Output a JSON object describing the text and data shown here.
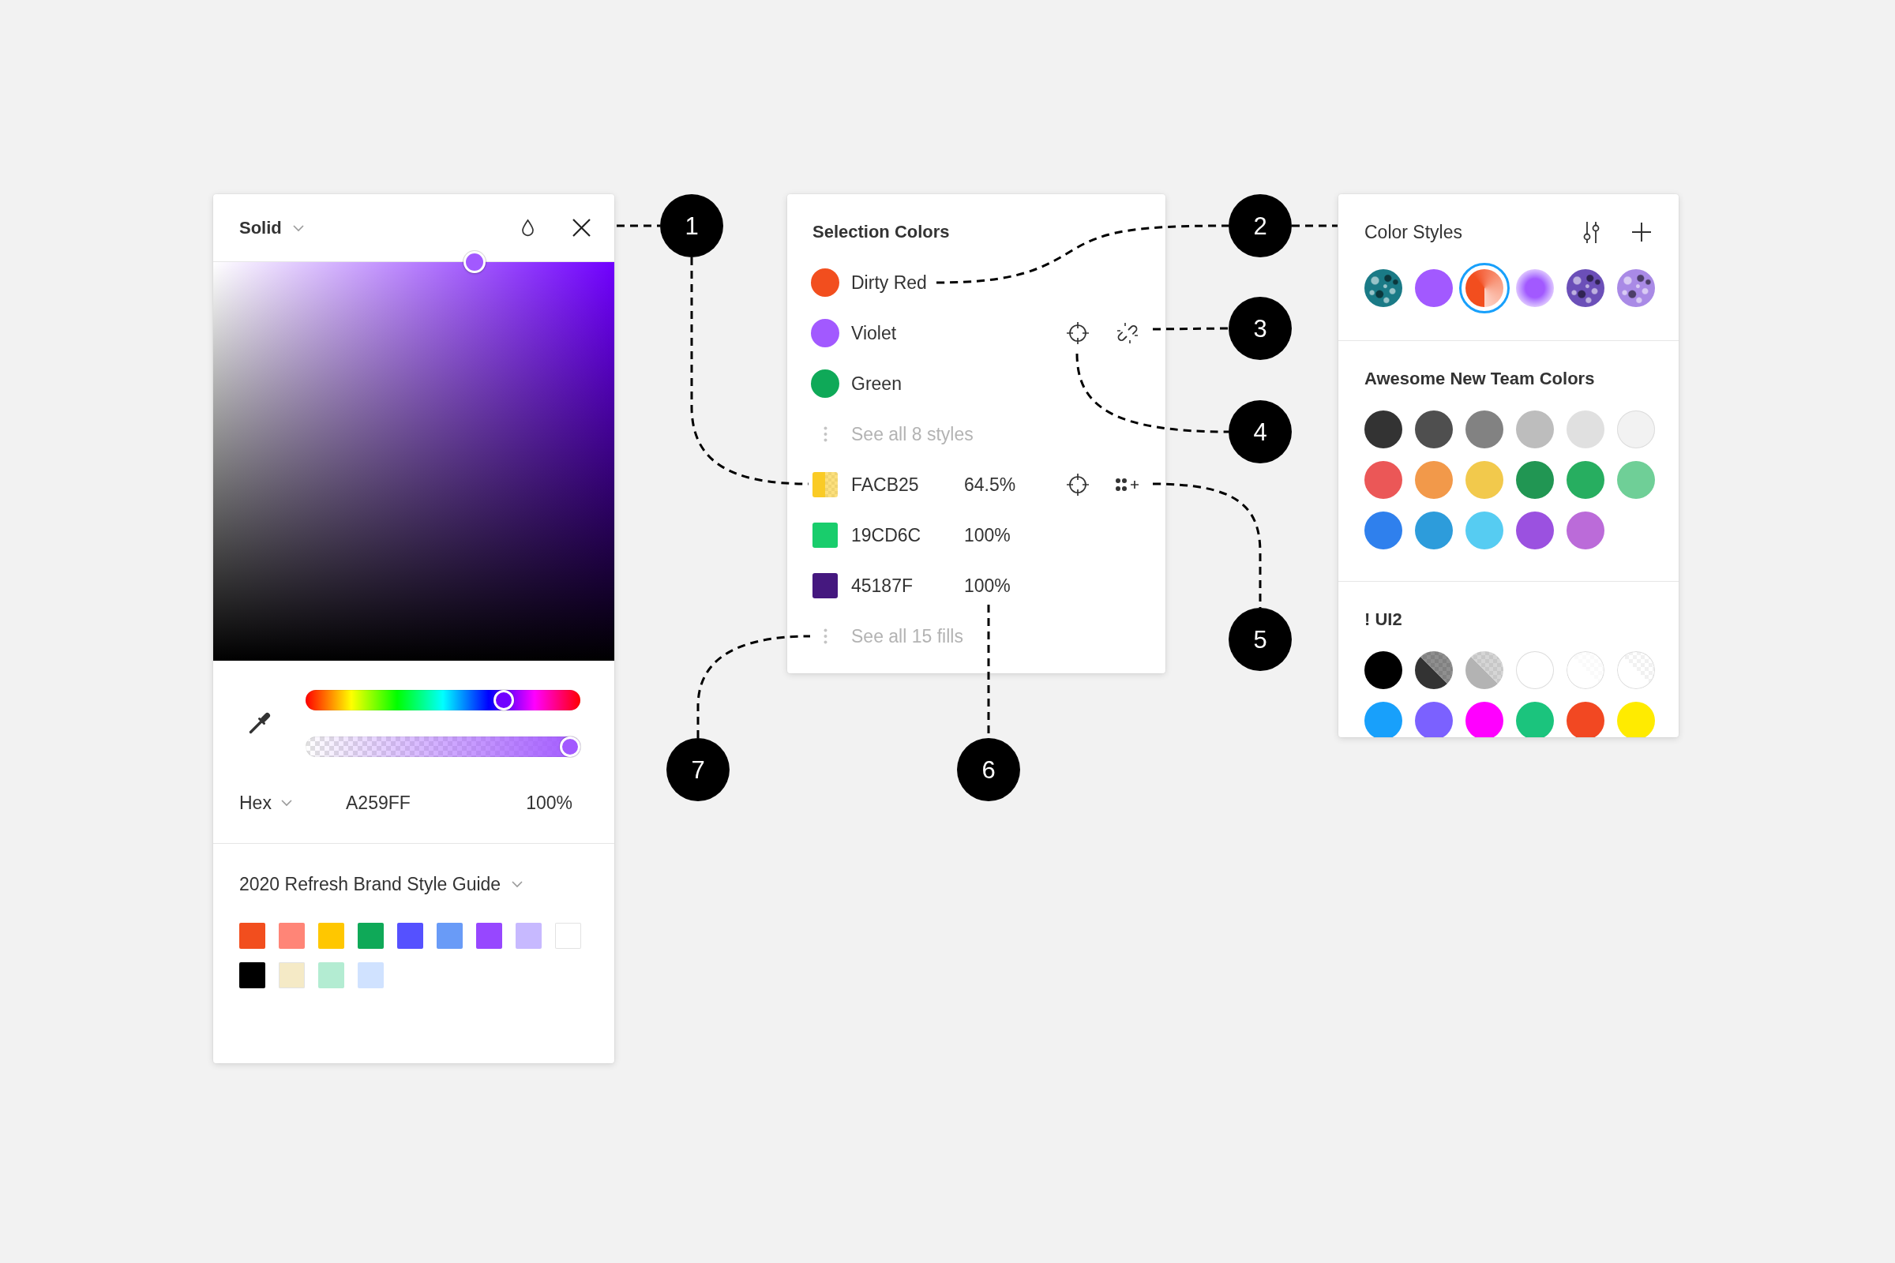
{
  "color_picker": {
    "fill_type": "Solid",
    "hue_slider": {
      "level": 0.74
    },
    "opacity_slider": {
      "level": 1
    },
    "format": "Hex",
    "hex_value": "A259FF",
    "opacity": "100%",
    "library": "2020 Refresh Brand Style Guide",
    "swatches": [
      {
        "color": "#f24e1e"
      },
      {
        "color": "#ff8577"
      },
      {
        "color": "#ffc700"
      },
      {
        "color": "#0fa958"
      },
      {
        "color": "#5551ff"
      },
      {
        "color": "#699bf7"
      },
      {
        "color": "#9747ff"
      },
      {
        "color": "#c7b9ff"
      },
      {
        "color": "#ffffff"
      },
      {
        "color": "#000000"
      },
      {
        "color": "#f5eac6"
      },
      {
        "color": "#b3ecd2"
      },
      {
        "color": "#d0e2ff"
      }
    ]
  },
  "selection_colors": {
    "title": "Selection Colors",
    "styles": [
      {
        "name": "Dirty Red",
        "color": "#f24e1e",
        "hovered": false
      },
      {
        "name": "Violet",
        "color": "#a259ff",
        "hovered": true
      },
      {
        "name": "Green",
        "color": "#0fa958",
        "hovered": false
      }
    ],
    "more_styles": "See all 8 styles",
    "fills": [
      {
        "hex": "FACB25",
        "opacity": "64.5%",
        "color": "#facb25",
        "translucent": true,
        "hovered": true
      },
      {
        "hex": "19CD6C",
        "opacity": "100%",
        "color": "#19cd6c",
        "translucent": false,
        "hovered": false
      },
      {
        "hex": "45187F",
        "opacity": "100%",
        "color": "#45187f",
        "translucent": false,
        "hovered": false
      }
    ],
    "more_fills": "See all 15 fills"
  },
  "color_styles": {
    "title": "Color Styles",
    "styles": [
      {
        "kind": "image",
        "color": "#1a7a86",
        "selected": false
      },
      {
        "kind": "solid",
        "color": "#a259ff",
        "selected": false
      },
      {
        "kind": "gradient",
        "color": "#f24e1e",
        "selected": true
      },
      {
        "kind": "radial",
        "color": "#a259ff",
        "selected": false
      },
      {
        "kind": "image",
        "color": "#6b4fb8",
        "selected": false
      },
      {
        "kind": "image",
        "color": "#a98ae6",
        "selected": false
      }
    ],
    "libraries": [
      {
        "name": "Awesome New Team Colors",
        "colors": [
          {
            "color": "#333333"
          },
          {
            "color": "#4f4f4f"
          },
          {
            "color": "#828282"
          },
          {
            "color": "#bdbdbd"
          },
          {
            "color": "#e0e0e0"
          },
          {
            "color": "#f2f2f2"
          },
          {
            "color": "#eb5757"
          },
          {
            "color": "#f2994a"
          },
          {
            "color": "#f2c94c"
          },
          {
            "color": "#219653"
          },
          {
            "color": "#27ae60"
          },
          {
            "color": "#6fcf97"
          },
          {
            "color": "#2f80ed"
          },
          {
            "color": "#2d9cdb"
          },
          {
            "color": "#56ccf2"
          },
          {
            "color": "#9b51e0"
          },
          {
            "color": "#bb6bd9"
          }
        ]
      },
      {
        "name": "! UI2",
        "colors": [
          {
            "color": "#000000",
            "kind": "solid"
          },
          {
            "color": "#333333",
            "kind": "split"
          },
          {
            "color": "#b3b3b3",
            "kind": "split"
          },
          {
            "color": "#ffffff",
            "kind": "solid"
          },
          {
            "color": "#ffffff",
            "kind": "faint"
          },
          {
            "color": "#ffffff",
            "kind": "split"
          },
          {
            "color": "#18a0fb",
            "kind": "solid"
          },
          {
            "color": "#7b61ff",
            "kind": "solid"
          },
          {
            "color": "#ff00ff",
            "kind": "solid"
          },
          {
            "color": "#1bc47d",
            "kind": "solid"
          },
          {
            "color": "#f24822",
            "kind": "solid"
          },
          {
            "color": "#ffeb00",
            "kind": "solid"
          }
        ]
      }
    ]
  },
  "callouts": [
    {
      "label": "1"
    },
    {
      "label": "2"
    },
    {
      "label": "3"
    },
    {
      "label": "4"
    },
    {
      "label": "5"
    },
    {
      "label": "6"
    },
    {
      "label": "7"
    }
  ]
}
